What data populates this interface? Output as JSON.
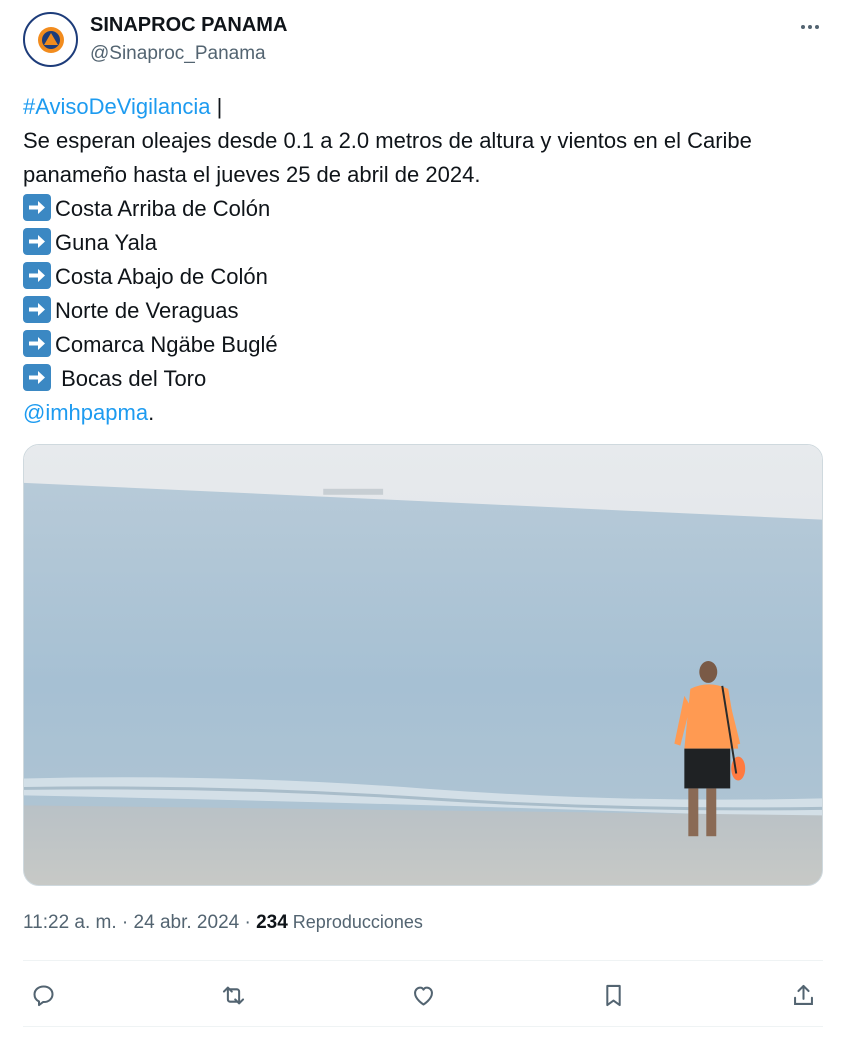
{
  "author": {
    "name": "SINAPROC PANAMA",
    "handle": "@Sinaproc_Panama",
    "avatar_icon": "sinaproc-logo",
    "avatar_border_color": "#1d3c7a"
  },
  "more_icon": "ellipsis-icon",
  "tweet": {
    "hashtag": "#AvisoDeVigilancia",
    "hashtag_suffix": " |",
    "line1": "Se esperan oleajes desde 0.1 a 2.0 metros de altura y vientos en el Caribe",
    "line2": "panameño hasta el jueves 25 de abril de 2024.",
    "list_icon": "right-arrow-emoji",
    "list": [
      "Costa Arriba de Colón",
      "Guna Yala",
      "Costa Abajo de Colón",
      "Norte de Veraguas",
      "Comarca Ngäbe Buglé",
      " Bocas del Toro"
    ],
    "mention": "@imhpapma",
    "mention_suffix": ".",
    "link_color": "#1d9bf0"
  },
  "media": {
    "alt_icon": "beach-photo",
    "description_colors": {
      "sky": "#dfe4e8",
      "sea": "#a9c3d5",
      "sand": "#bfc5c6",
      "shirt": "#ff9a52"
    }
  },
  "meta": {
    "time": "11:22 a. m.",
    "sep": " · ",
    "date": "24 abr. 2024",
    "views_count": "234",
    "views_label": " Reproducciones"
  },
  "actions": [
    {
      "name": "reply-icon"
    },
    {
      "name": "retweet-icon"
    },
    {
      "name": "like-icon"
    },
    {
      "name": "bookmark-icon"
    },
    {
      "name": "share-icon"
    }
  ]
}
